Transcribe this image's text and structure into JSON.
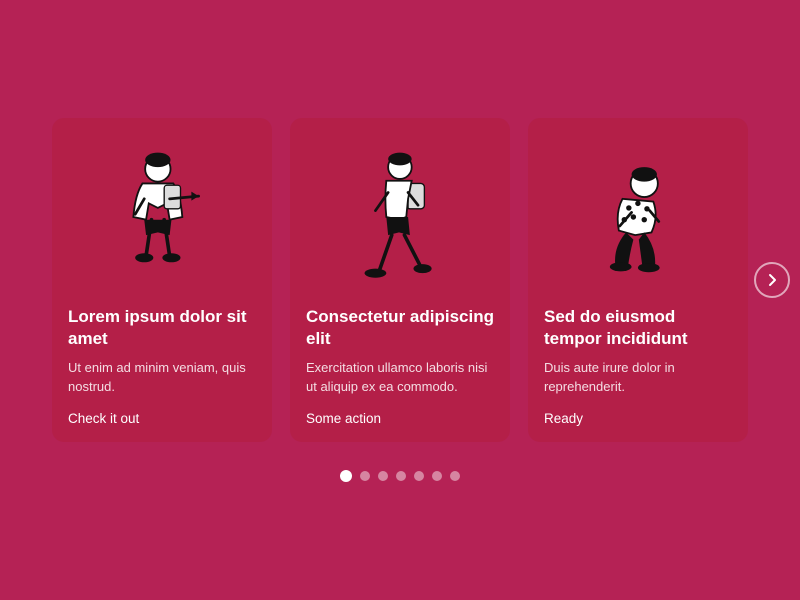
{
  "cards": [
    {
      "id": "card-1",
      "title": "Lorem ipsum dolor sit amet",
      "body": "Ut enim ad minim veniam, quis nostrud.",
      "link": "Check it out",
      "figure": "person-pointing"
    },
    {
      "id": "card-2",
      "title": "Consectetur adipiscing elit",
      "body": "Exercitation ullamco laboris nisi ut aliquip ex ea commodo.",
      "link": "Some action",
      "figure": "person-walking"
    },
    {
      "id": "card-3",
      "title": "Sed do eiusmod tempor incididunt",
      "body": "Duis aute irure dolor in reprehenderit.",
      "link": "Ready",
      "figure": "person-crouching"
    }
  ],
  "dots": [
    {
      "active": true
    },
    {
      "active": false
    },
    {
      "active": false
    },
    {
      "active": false
    },
    {
      "active": false
    },
    {
      "active": false
    },
    {
      "active": false
    }
  ],
  "arrow": "›"
}
